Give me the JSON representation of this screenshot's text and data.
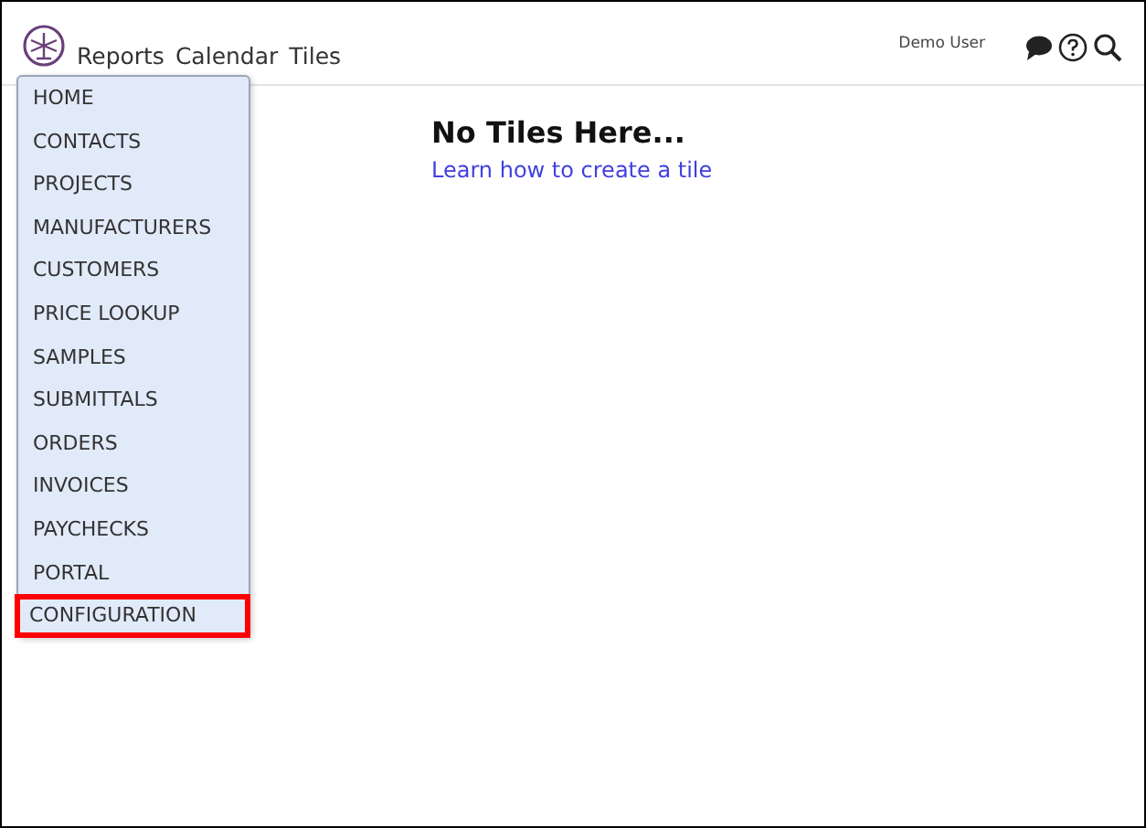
{
  "nav": {
    "links": [
      "Reports",
      "Calendar",
      "Tiles"
    ],
    "user": "Demo User"
  },
  "menu": [
    {
      "label": "HOME",
      "highlighted": false
    },
    {
      "label": "CONTACTS",
      "highlighted": false
    },
    {
      "label": "PROJECTS",
      "highlighted": false
    },
    {
      "label": "MANUFACTURERS",
      "highlighted": false
    },
    {
      "label": "CUSTOMERS",
      "highlighted": false
    },
    {
      "label": "PRICE LOOKUP",
      "highlighted": false
    },
    {
      "label": "SAMPLES",
      "highlighted": false
    },
    {
      "label": "SUBMITTALS",
      "highlighted": false
    },
    {
      "label": "ORDERS",
      "highlighted": false
    },
    {
      "label": "INVOICES",
      "highlighted": false
    },
    {
      "label": "PAYCHECKS",
      "highlighted": false
    },
    {
      "label": "PORTAL",
      "highlighted": false
    },
    {
      "label": "CONFIGURATION",
      "highlighted": true
    }
  ],
  "content": {
    "heading": "No Tiles Here...",
    "link": "Learn how to create a tile"
  }
}
